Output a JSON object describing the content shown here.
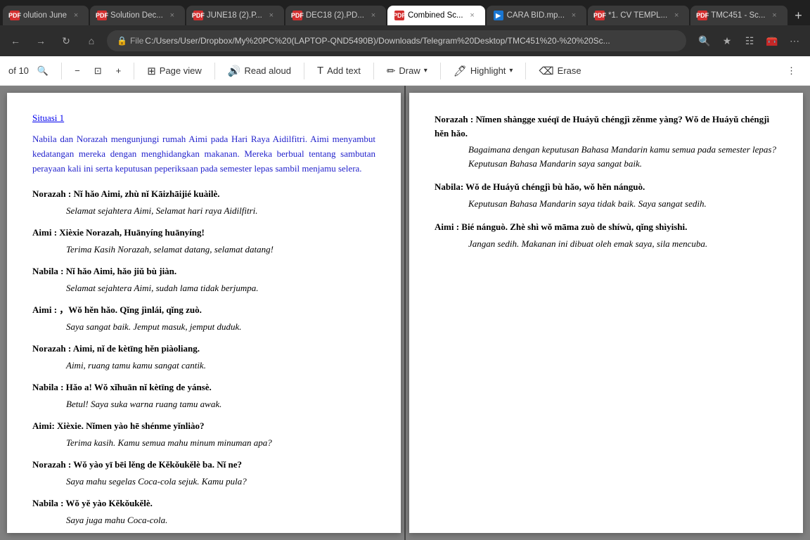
{
  "browser": {
    "tabs": [
      {
        "id": "tab1",
        "label": "olution June",
        "icon": "pdf",
        "active": false
      },
      {
        "id": "tab2",
        "label": "Solution Dec...",
        "icon": "pdf",
        "active": false
      },
      {
        "id": "tab3",
        "label": "JUNE18 (2).P...",
        "icon": "pdf",
        "active": false
      },
      {
        "id": "tab4",
        "label": "DEC18 (2).PD...",
        "icon": "pdf",
        "active": false
      },
      {
        "id": "tab5",
        "label": "Combined Sc...",
        "icon": "pdf",
        "active": true
      },
      {
        "id": "tab6",
        "label": "CARA BID.mp...",
        "icon": "video",
        "active": false
      },
      {
        "id": "tab7",
        "label": "*1. CV TEMPL...",
        "icon": "pdf",
        "active": false
      },
      {
        "id": "tab8",
        "label": "TMC451 - Sc...",
        "icon": "pdf",
        "active": false
      }
    ],
    "address": "C:/Users/User/Dropbox/My%20PC%20(LAPTOP-QND5490B)/Downloads/Telegram%20Desktop/TMC451%20-%20%20Sc...",
    "nav": {
      "back": "←",
      "forward": "→",
      "refresh": "↻",
      "home": "⌂"
    }
  },
  "toolbar": {
    "page_current": "",
    "page_total": "of 10",
    "zoom_out": "−",
    "zoom_in": "+",
    "fit": "⊡",
    "page_view_label": "Page view",
    "read_aloud_label": "Read aloud",
    "add_text_label": "Add text",
    "draw_label": "Draw",
    "highlight_label": "Highlight",
    "erase_label": "Erase",
    "search_icon": "🔍"
  },
  "left_page": {
    "situation_title": "Situasi 1",
    "intro": "Nabila dan Norazah mengunjungi rumah Aimi pada Hari Raya Aidilfitri. Aimi menyambut kedatangan mereka dengan menghidangkan makanan. Mereka berbual tentang sambutan perayaan kali ini serta keputusan peperiksaan pada semester lepas sambil menjamu selera.",
    "dialogs": [
      {
        "speaker": "Norazah : Nǐ hǎo Aimi, zhù nǐ Kāizhāijié kuàilè.",
        "translation": "Selamat sejahtera Aimi, Selamat hari raya Aidilfitri."
      },
      {
        "speaker": "Aimi : Xièxie Norazah, Huānyíng huānyíng!",
        "translation": "Terima Kasih Norazah, selamat datang, selamat datang!"
      },
      {
        "speaker": "Nabila : Nǐ hǎo Aimi, hǎo jiǔ bù jiàn.",
        "translation": "Selamat sejahtera Aimi, sudah lama tidak berjumpa."
      },
      {
        "speaker": "Aimi : ，Wǒ hěn hǎo. Qǐng jìnlái, qǐng zuò.",
        "translation": "Saya sangat baik. Jemput masuk, jemput duduk."
      },
      {
        "speaker": "Norazah : Aimi, nǐ de kètīng hěn piàoliang.",
        "translation": "Aimi, ruang tamu kamu sangat cantik."
      },
      {
        "speaker": "Nabila : Hǎo a! Wǒ xǐhuān nǐ kètīng de yánsè.",
        "translation": "Betul! Saya suka warna ruang tamu awak."
      },
      {
        "speaker": "Aimi: Xièxie. Nǐmen yào hē shénme yǐnliào?",
        "translation": "Terima kasih. Kamu semua mahu minum minuman apa?"
      },
      {
        "speaker": "Norazah : Wǒ yào yī bēi lěng de Kěkǒukělè ba. Nǐ ne?",
        "translation": "Saya mahu segelas Coca-cola sejuk. Kamu pula?"
      },
      {
        "speaker": "Nabila : Wǒ yě yào Kěkǒukělè.",
        "translation": "Saya juga mahu Coca-cola."
      }
    ]
  },
  "right_page": {
    "dialogs": [
      {
        "speaker": "Norazah : Nǐmen shàngge xuéqī de Huáyǔ chéngjì zěnme yàng? Wǒ de Huáyǔ chéngjì hěn hǎo.",
        "translation": "Bagaimana dengan keputusan Bahasa Mandarin  kamu semua pada semester lepas? Keputusan Bahasa Mandarin saya sangat baik."
      },
      {
        "speaker": "Nabila: Wǒ de Huáyǔ chéngjì bù hǎo, wǒ hěn nánguò.",
        "translation": "Keputusan Bahasa Mandarin saya tidak baik. Saya sangat sedih."
      },
      {
        "speaker": "Aimi : Bié nánguò. Zhè shì wǒ māma zuò de shíwù, qǐng shìyishi.",
        "translation": "Jangan sedih. Makanan ini dibuat oleh emak saya, sila mencuba."
      }
    ]
  }
}
